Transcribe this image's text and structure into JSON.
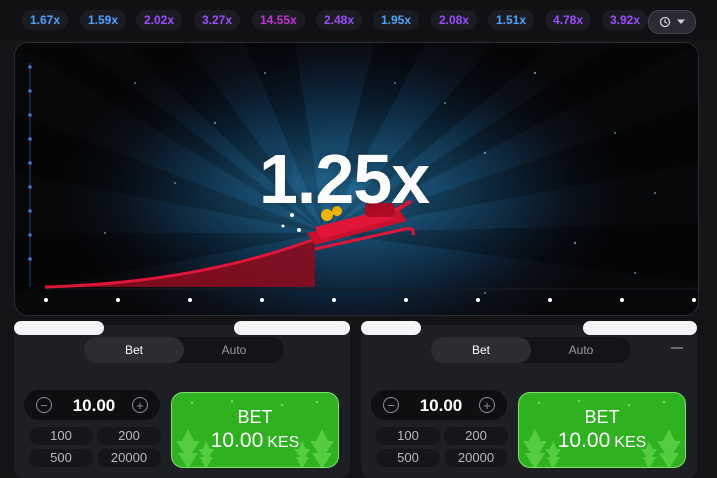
{
  "history": {
    "multipliers": [
      {
        "value": "1.67x",
        "color": "#4aa3ff"
      },
      {
        "value": "1.59x",
        "color": "#4aa3ff"
      },
      {
        "value": "2.02x",
        "color": "#9a4dff"
      },
      {
        "value": "3.27x",
        "color": "#9a4dff"
      },
      {
        "value": "14.55x",
        "color": "#c330d6"
      },
      {
        "value": "2.48x",
        "color": "#9a4dff"
      },
      {
        "value": "1.95x",
        "color": "#4aa3ff"
      },
      {
        "value": "2.08x",
        "color": "#9a4dff"
      },
      {
        "value": "1.51x",
        "color": "#4aa3ff"
      },
      {
        "value": "4.78x",
        "color": "#9a4dff"
      },
      {
        "value": "3.92x",
        "color": "#9a4dff"
      }
    ],
    "history_button_icons": [
      "clock-history-icon",
      "chevron-down-icon"
    ]
  },
  "game": {
    "current_multiplier": "1.25x",
    "curve_color": "#e0153a"
  },
  "panels": [
    {
      "tabs": {
        "bet": "Bet",
        "auto": "Auto"
      },
      "amount": "10.00",
      "quick_amounts": [
        "100",
        "200",
        "500",
        "20000"
      ],
      "bet_button": {
        "label": "BET",
        "amount": "10.00",
        "currency": "KES"
      }
    },
    {
      "tabs": {
        "bet": "Bet",
        "auto": "Auto"
      },
      "amount": "10.00",
      "quick_amounts": [
        "100",
        "200",
        "500",
        "20000"
      ],
      "bet_button": {
        "label": "BET",
        "amount": "10.00",
        "currency": "KES"
      }
    }
  ],
  "colors": {
    "bet_green": "#2fb21f",
    "accent_blue": "#3d7bd9"
  }
}
